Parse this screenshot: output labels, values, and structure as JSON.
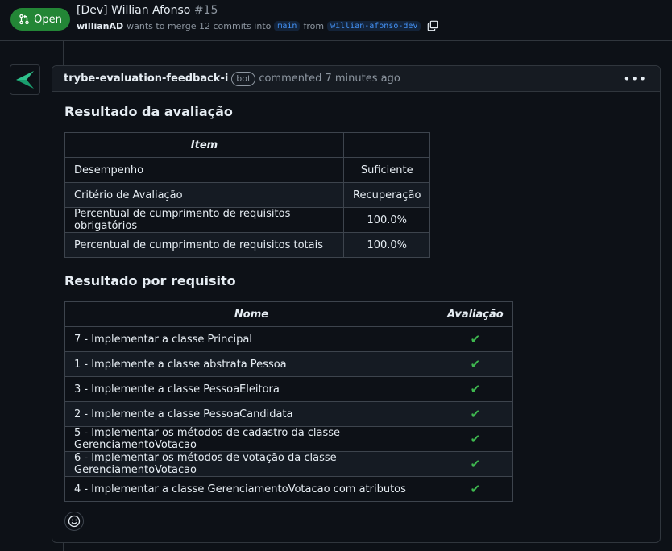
{
  "pr": {
    "state": "Open",
    "title": "[Dev] Willian Afonso",
    "number": "#15",
    "author": "willianAD",
    "merge_text": "wants to merge 12 commits into",
    "base_branch": "main",
    "from_text": "from",
    "head_branch": "willian-afonso-dev"
  },
  "comment": {
    "author": "trybe-evaluation-feedback-i",
    "badge": "bot",
    "time": "commented 7 minutes ago",
    "menu_icon": "kebab-horizontal-icon",
    "section1_title": "Resultado da avaliação",
    "eval_table": {
      "header": "Item",
      "rows": [
        {
          "item": "Desempenho",
          "value": "Suficiente"
        },
        {
          "item": "Critério de Avaliação",
          "value": "Recuperação"
        },
        {
          "item": "Percentual de cumprimento de requisitos obrigatórios",
          "value": "100.0%"
        },
        {
          "item": "Percentual de cumprimento de requisitos totais",
          "value": "100.0%"
        }
      ]
    },
    "section2_title": "Resultado por requisito",
    "req_table": {
      "headers": [
        "Nome",
        "Avaliação"
      ],
      "rows": [
        {
          "nome": "7 - Implementar a classe Principal",
          "mark": "✔"
        },
        {
          "nome": "1 - Implemente a classe abstrata Pessoa",
          "mark": "✔"
        },
        {
          "nome": "3 - Implemente a classe PessoaEleitora",
          "mark": "✔"
        },
        {
          "nome": "2 - Implemente a classe PessoaCandidata",
          "mark": "✔"
        },
        {
          "nome": "5 - Implementar os métodos de cadastro da classe GerenciamentoVotacao",
          "mark": "✔"
        },
        {
          "nome": "6 - Implementar os métodos de votação da classe GerenciamentoVotacao",
          "mark": "✔"
        },
        {
          "nome": "4 - Implementar a classe GerenciamentoVotacao com atributos",
          "mark": "✔"
        }
      ]
    }
  },
  "colors": {
    "open_green": "#238636",
    "check_green": "#3fb950",
    "link_blue": "#4493f8",
    "background": "#0d1117"
  }
}
